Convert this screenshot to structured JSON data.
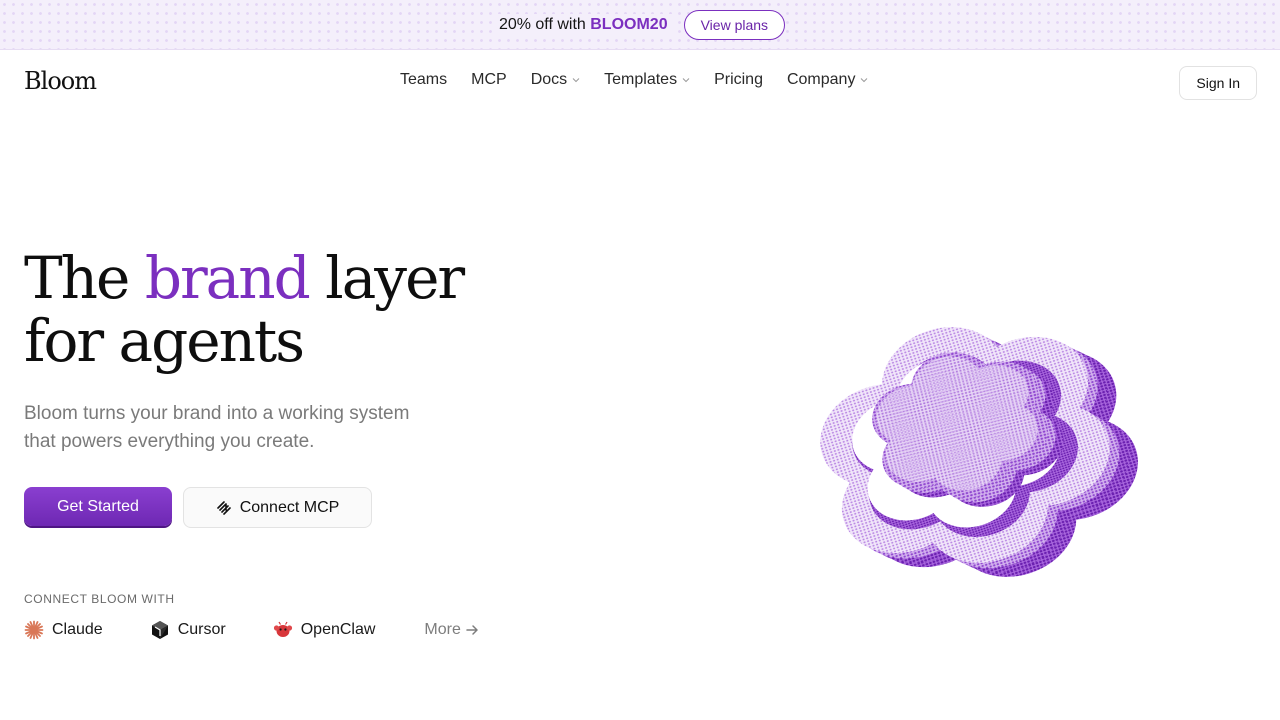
{
  "promo": {
    "text_prefix": "20% off with ",
    "code": "BLOOM20",
    "button_label": "View plans"
  },
  "nav": {
    "logo": "Bloom",
    "items": [
      {
        "label": "Teams",
        "has_dropdown": false
      },
      {
        "label": "MCP",
        "has_dropdown": false
      },
      {
        "label": "Docs",
        "has_dropdown": true
      },
      {
        "label": "Templates",
        "has_dropdown": true
      },
      {
        "label": "Pricing",
        "has_dropdown": false
      },
      {
        "label": "Company",
        "has_dropdown": true
      }
    ],
    "signin_label": "Sign In"
  },
  "hero": {
    "title_part1": "The ",
    "title_accent": "brand",
    "title_part2": " layer",
    "title_line2": "for agents",
    "subtitle": "Bloom turns your brand into a working system that powers everything you create.",
    "primary_cta": "Get Started",
    "secondary_cta": "Connect MCP"
  },
  "integrations": {
    "label": "CONNECT BLOOM WITH",
    "items": [
      {
        "label": "Claude",
        "icon": "claude-icon"
      },
      {
        "label": "Cursor",
        "icon": "cursor-icon"
      },
      {
        "label": "OpenClaw",
        "icon": "openclaw-icon"
      }
    ],
    "more_label": "More"
  },
  "colors": {
    "accent": "#7b2fbf",
    "promo_bg": "#f4effb",
    "illustration": "#8d3fd0"
  }
}
